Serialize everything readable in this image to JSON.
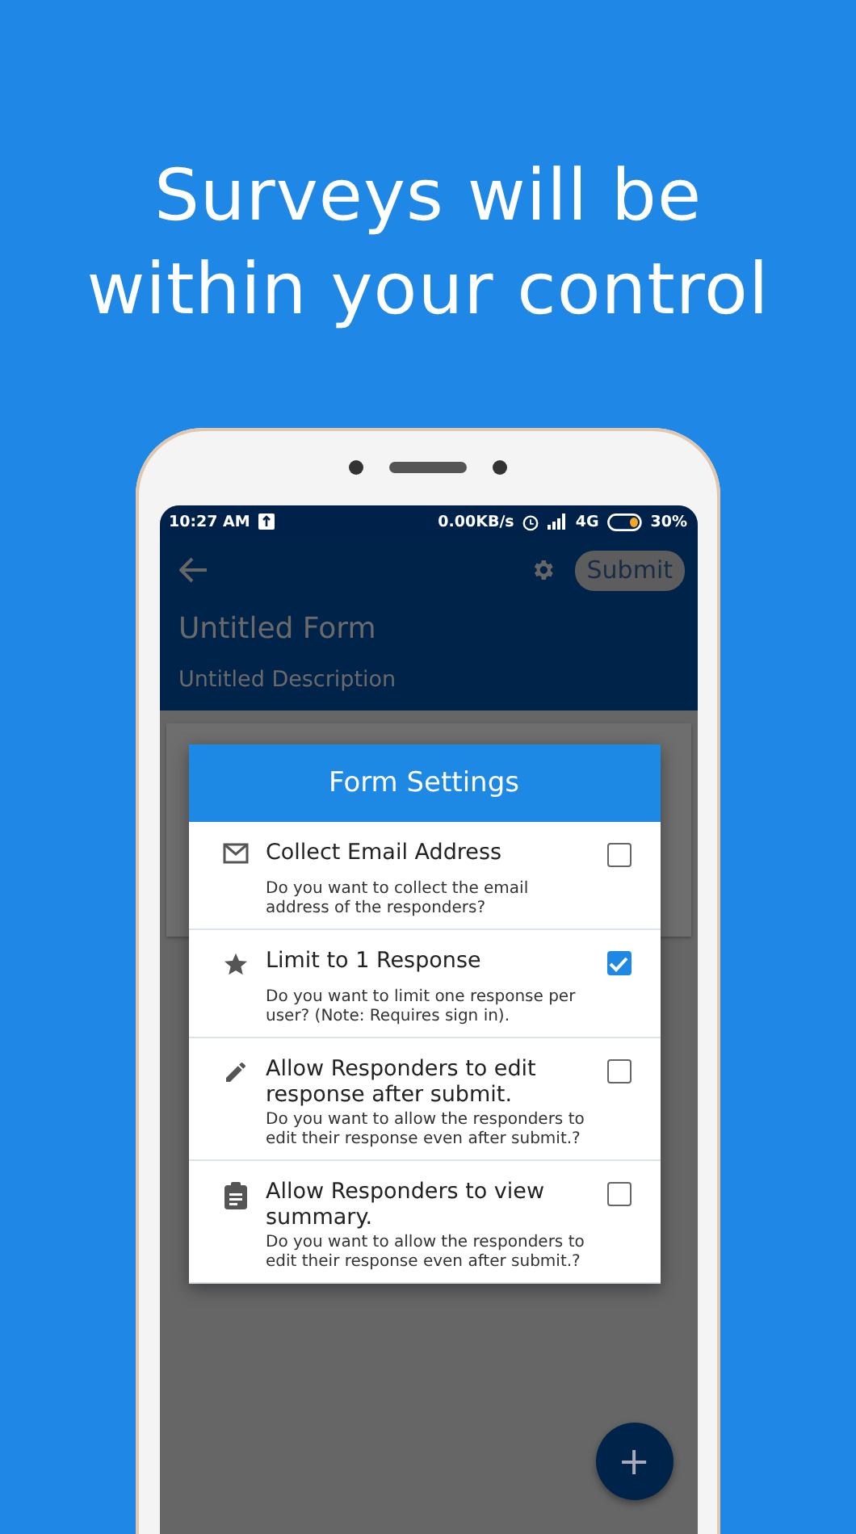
{
  "headline": "Surveys will be within your control",
  "status_bar": {
    "time": "10:27 AM",
    "speed": "0.00KB/s",
    "network": "4G",
    "battery": "30%"
  },
  "app_bar": {
    "submit": "Submit"
  },
  "form": {
    "title": "Untitled Form",
    "description": "Untitled Description"
  },
  "dialog": {
    "title": "Form Settings",
    "settings": [
      {
        "title": "Collect Email Address",
        "description": "Do you want to collect the email address of the responders?",
        "checked": false
      },
      {
        "title": "Limit to 1 Response",
        "description": "Do you want to limit one response per user? (Note: Requires sign in).",
        "checked": true
      },
      {
        "title": "Allow Responders to edit response after submit.",
        "description": "Do you want to allow the responders to edit their response even after submit.?",
        "checked": false
      },
      {
        "title": "Allow Responders to view summary.",
        "description": "Do you want to allow the responders to edit their response even after submit.?",
        "checked": false
      }
    ]
  },
  "fab": {
    "label": "+"
  }
}
